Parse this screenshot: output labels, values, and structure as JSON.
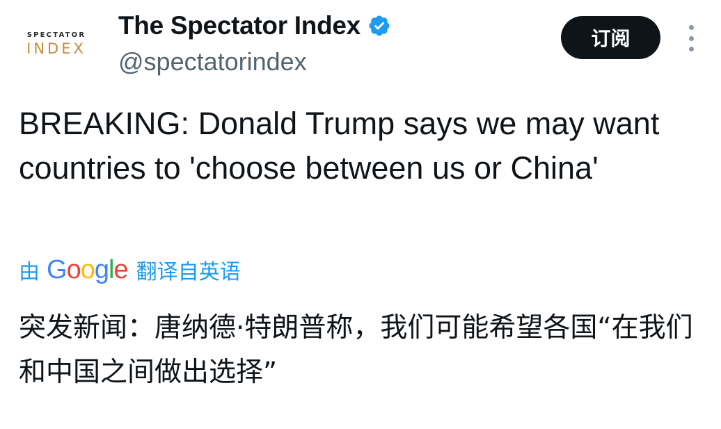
{
  "author": {
    "avatar_top": "SPECTATOR",
    "avatar_bottom": "INDEX",
    "name": "The Spectator Index",
    "handle": "@spectatorindex",
    "verified_icon": "verified-badge-icon",
    "verified_color": "#1d9bf0"
  },
  "actions": {
    "subscribe_label": "订阅",
    "more_icon": "vertical-ellipsis-icon"
  },
  "tweet": {
    "text": "BREAKING: Donald Trump says we may want countries to 'choose between us or China'"
  },
  "translation": {
    "prefix": "由",
    "provider_letters": [
      "G",
      "o",
      "o",
      "g",
      "l",
      "e"
    ],
    "provider_colors": [
      "#4285f4",
      "#ea4335",
      "#fbbc05",
      "#4285f4",
      "#34a853",
      "#ea4335"
    ],
    "suffix": "翻译自英语",
    "text": "突发新闻：唐纳德·特朗普称，我们可能希望各国“在我们和中国之间做出选择”"
  },
  "colors": {
    "link": "#1d9bf0",
    "text": "#0f1419",
    "secondary": "#536471"
  }
}
